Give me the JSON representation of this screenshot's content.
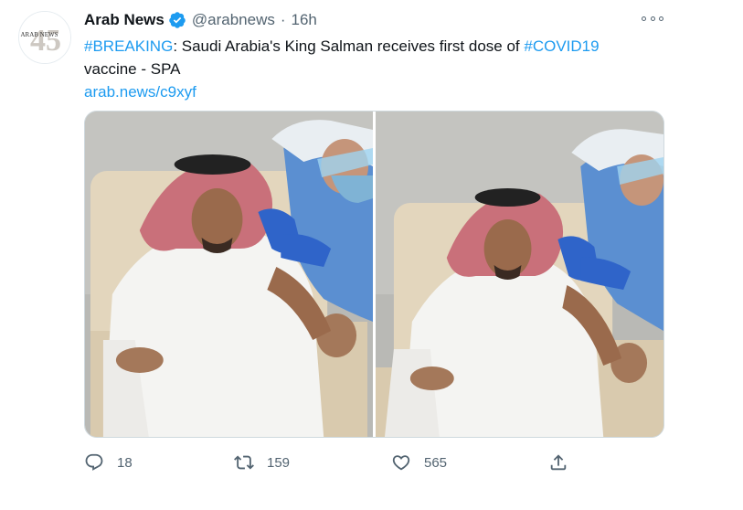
{
  "account": {
    "display_name": "Arab News",
    "handle": "@arabnews",
    "separator": "·",
    "time": "16h",
    "verified": true,
    "avatar_text": "ARAB NEWS",
    "avatar_number": "45"
  },
  "tweet": {
    "hashtag_breaking": "#BREAKING",
    "text_main": ": Saudi Arabia's King Salman receives first dose of ",
    "hashtag_covid": "#COVID19",
    "text_line2": "vaccine - SPA",
    "link": "arab.news/c9xyf"
  },
  "media": {
    "count": 2
  },
  "actions": {
    "reply_count": "18",
    "retweet_count": "159",
    "like_count": "565"
  },
  "icons": {
    "verified": "verified-badge-icon",
    "more": "more-options-icon",
    "reply": "reply-icon",
    "retweet": "retweet-icon",
    "like": "like-icon",
    "share": "share-icon"
  },
  "colors": {
    "accent": "#1d9bf0",
    "text": "#0f1419",
    "muted": "#536471",
    "border": "#cfd9de"
  }
}
